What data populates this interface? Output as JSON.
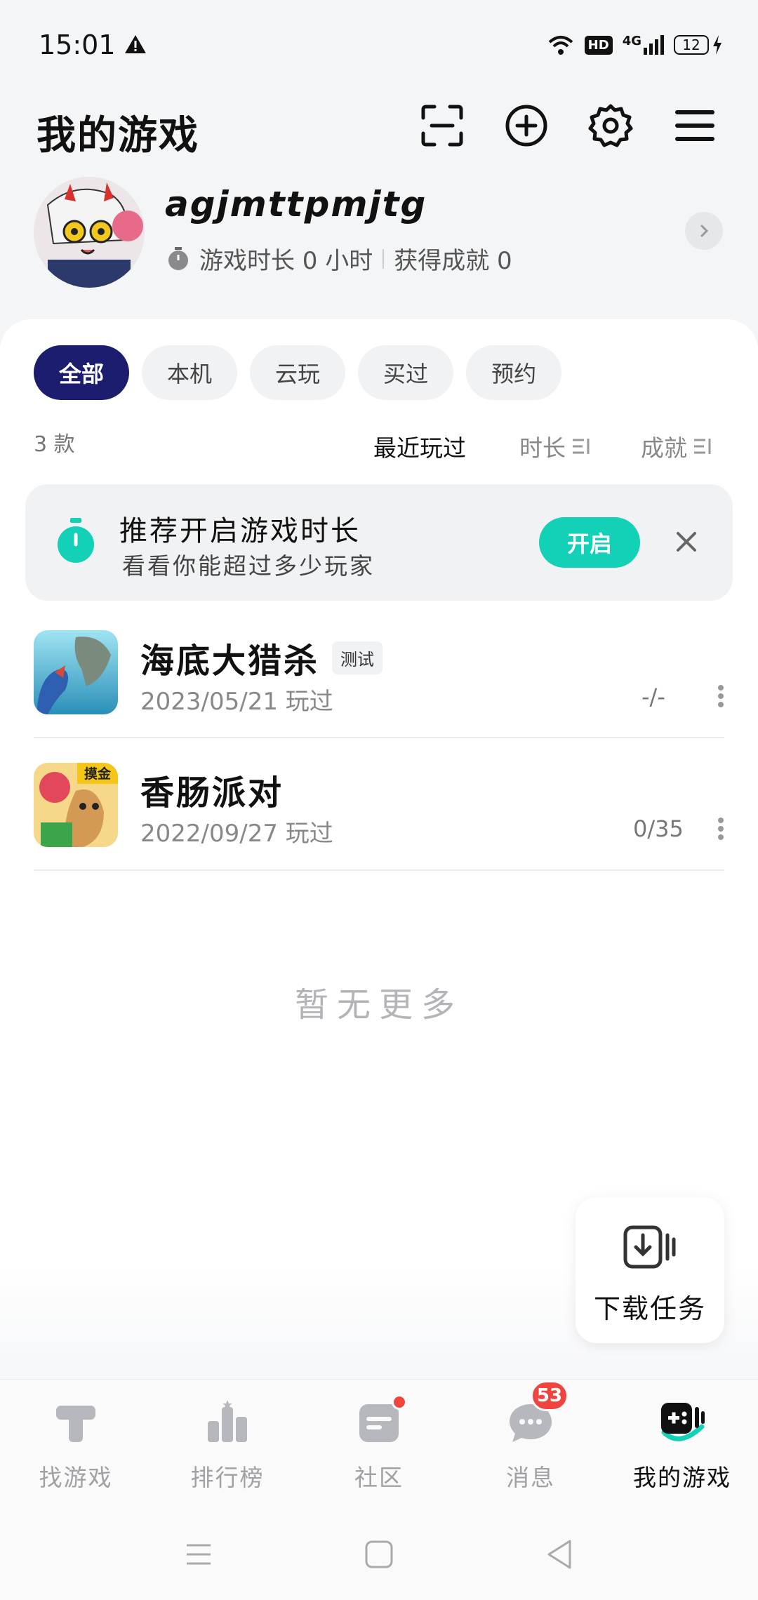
{
  "status_bar": {
    "time": "15:01",
    "hd_badge": "HD",
    "network": "4G",
    "battery": "12"
  },
  "header": {
    "title": "我的游戏",
    "icons": [
      "scan-icon",
      "add-circle-icon",
      "gear-icon",
      "menu-icon"
    ]
  },
  "profile": {
    "username": "agjmttpmjtg",
    "playtime_text": "游戏时长 0 小时",
    "achievement_text": "获得成就 0"
  },
  "filters": {
    "chips": [
      "全部",
      "本机",
      "云玩",
      "买过",
      "预约"
    ],
    "active_index": 0
  },
  "sort_bar": {
    "count": "3 款",
    "recent": "最近玩过",
    "duration": "时长",
    "achievement": "成就"
  },
  "promo": {
    "title": "推荐开启游戏时长",
    "subtitle": "看看你能超过多少玩家",
    "button": "开启"
  },
  "games": [
    {
      "name": "海底大猎杀",
      "tag": "测试",
      "last_played": "2023/05/21 玩过",
      "achievement": "-/-"
    },
    {
      "name": "香肠派对",
      "icon_badge": "摸金",
      "last_played": "2022/09/27 玩过",
      "achievement": "0/35"
    }
  ],
  "empty_text": "暂无更多",
  "download_task": {
    "label": "下载任务"
  },
  "bottom_nav": {
    "items": [
      {
        "label": "找游戏",
        "icon": "t-game-icon"
      },
      {
        "label": "排行榜",
        "icon": "ranking-icon"
      },
      {
        "label": "社区",
        "icon": "community-icon"
      },
      {
        "label": "消息",
        "icon": "message-icon",
        "badge": "53"
      },
      {
        "label": "我的游戏",
        "icon": "my-games-icon"
      }
    ],
    "active_index": 4
  },
  "colors": {
    "accent_teal": "#12d1b6",
    "chip_active": "#1c1d6f",
    "badge_red": "#f0443f"
  }
}
